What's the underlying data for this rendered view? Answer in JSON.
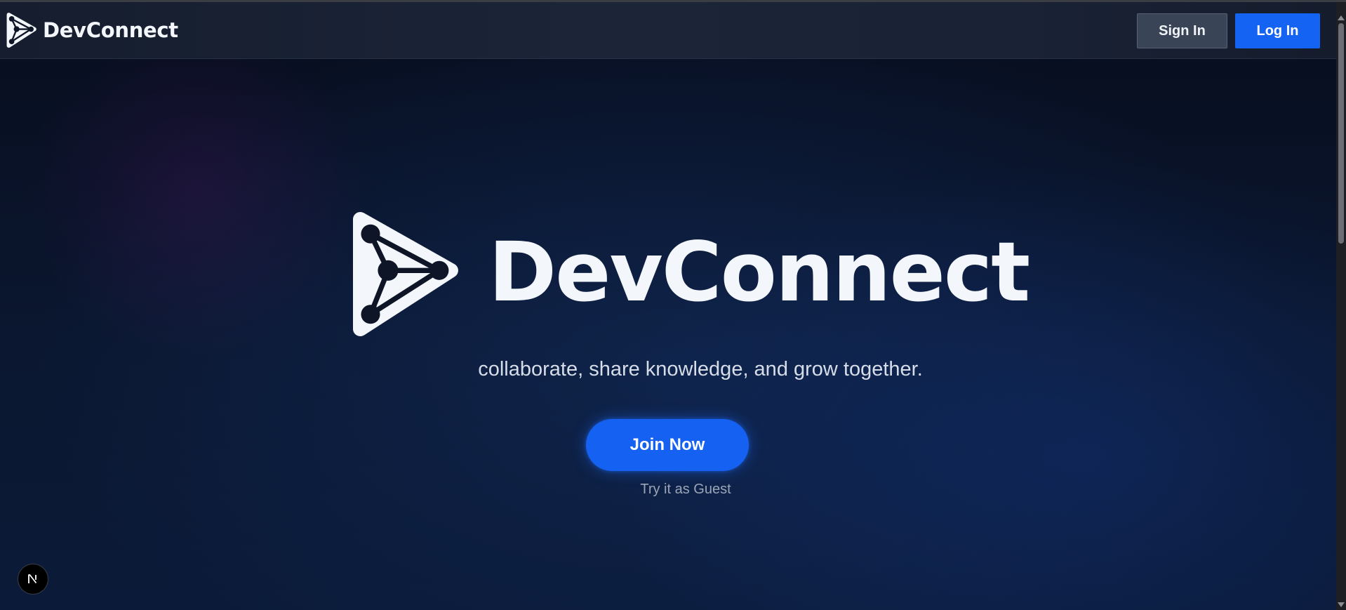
{
  "colors": {
    "background": "#0a1428",
    "navbar": "#1a2236",
    "accent_blue": "#1463f3",
    "sign_in_bg": "#3a4457",
    "text_primary": "#f3f6fb",
    "text_muted": "#9aa6b8"
  },
  "navbar": {
    "brand_icon": "devconnect-logo-icon",
    "brand_name": "DevConnect",
    "sign_in_label": "Sign In",
    "log_in_label": "Log In"
  },
  "hero": {
    "logo_icon": "devconnect-logo-icon",
    "title": "DevConnect",
    "tagline": "collaborate, share knowledge, and grow together.",
    "join_label": "Join Now",
    "guest_label": "Try it as Guest"
  },
  "dev_badge": {
    "icon": "nextjs-n-icon",
    "label": "N"
  }
}
